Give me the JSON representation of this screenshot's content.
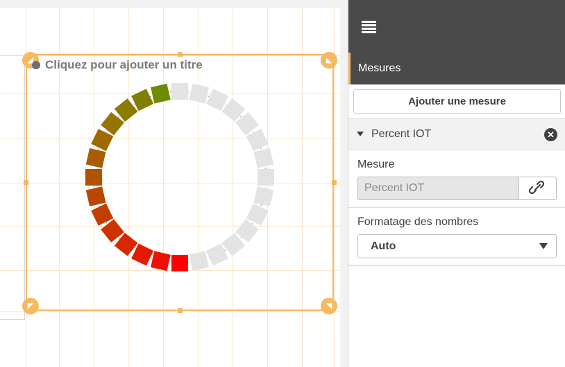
{
  "canvas": {
    "chart_title": "Cliquez pour ajouter un titre"
  },
  "gauge": {
    "filled_segments": 12,
    "total_segments": 28,
    "segment_colors": [
      "#ff0000",
      "#ef1000",
      "#e41a00",
      "#d82600",
      "#cc3300",
      "#c23e00",
      "#ba4700",
      "#b25200",
      "#a95c00",
      "#9f6900",
      "#957400",
      "#8b7c00",
      "#807f00",
      "#6d8c00"
    ],
    "empty_color": "#e3e3e3"
  },
  "panel": {
    "section_title": "Mesures",
    "add_button_label": "Ajouter une mesure",
    "measure_name": "Percent IOT",
    "measure_label": "Mesure",
    "measure_value": "Percent IOT",
    "format_label": "Formatage des nombres",
    "format_value": "Auto"
  },
  "colors": {
    "accent": "#f4b860",
    "header_bg": "#4a4a4a"
  }
}
